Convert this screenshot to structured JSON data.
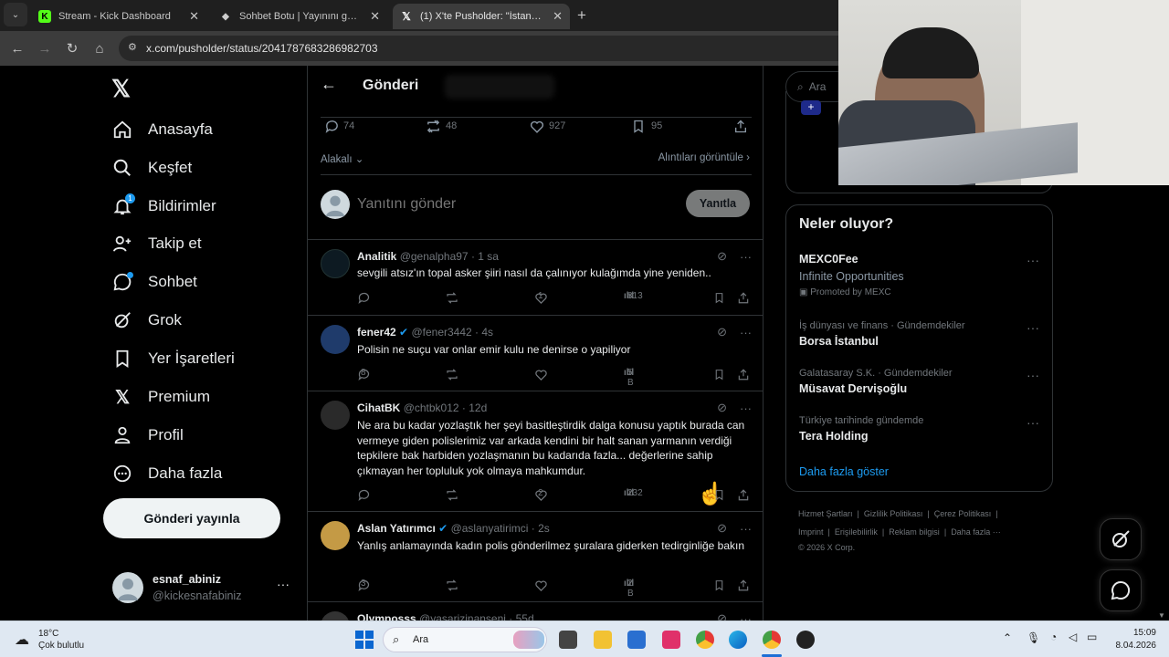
{
  "browser": {
    "tabs": [
      {
        "title": "Stream - Kick Dashboard",
        "icon": "kick-icon"
      },
      {
        "title": "Sohbet Botu | Yayınını güçlendir",
        "icon": "bot-icon"
      },
      {
        "title": "(1) X'te Pusholder: \"İstanbul Cu",
        "icon": "x-icon"
      }
    ],
    "url": "x.com/pusholder/status/2041787683286982703"
  },
  "nav": {
    "items": [
      {
        "label": "Anasayfa"
      },
      {
        "label": "Keşfet"
      },
      {
        "label": "Bildirimler",
        "badge": "1"
      },
      {
        "label": "Takip et"
      },
      {
        "label": "Sohbet"
      },
      {
        "label": "Grok"
      },
      {
        "label": "Yer İşaretleri"
      },
      {
        "label": "Premium"
      },
      {
        "label": "Profil"
      },
      {
        "label": "Daha fazla"
      }
    ],
    "post_button": "Gönderi yayınla",
    "account": {
      "name": "esnaf_abiniz",
      "handle": "@kickesnafabiniz"
    }
  },
  "post": {
    "header_title": "Gönderi",
    "stats": {
      "replies": "74",
      "reposts": "48",
      "likes": "927",
      "bookmarks": "95"
    },
    "sort_label": "Alakalı",
    "quotes_label": "Alıntıları görüntüle",
    "reply_placeholder": "Yanıtını gönder",
    "reply_button": "Yanıtla"
  },
  "replies": [
    {
      "name": "Analitik",
      "handle": "@genalpha97",
      "time": "· 1 sa",
      "verified": false,
      "text": "sevgili atsız'ın topal asker şiiri nasıl da çalınıyor kulağımda yine yeniden..",
      "likes": "1",
      "views": "813"
    },
    {
      "name": "fener42",
      "handle": "@fener3442",
      "time": "· 4s",
      "verified": true,
      "text": "Polisin ne suçu var onlar emir kulu ne denirse o yapiliyor",
      "likes": "",
      "views": "5 B",
      "replies": "8"
    },
    {
      "name": "CihatBK",
      "handle": "@chtbk012",
      "time": "· 12d",
      "verified": false,
      "text": "Ne ara bu kadar yozlaştık her şeyi basitleştirdik dalga konusu yaptık burada can vermeye giden polislerimiz var arkada kendini bir halt sanan yarmanın verdiği tepkilere bak harbiden yozlaşmanın bu kadarıda fazla... değerlerine sahip çıkmayan her topluluk yok olmaya mahkumdur.",
      "likes": "2",
      "views": "232"
    },
    {
      "name": "Aslan Yatırımcı",
      "handle": "@aslanyatirimci",
      "time": "· 2s",
      "verified": true,
      "text": "Yanlış anlamayında kadın polis gönderilmez şuralara giderken tedirginliğe bakın",
      "likes": "",
      "views": "2 B",
      "replies": "3"
    },
    {
      "name": "Olymposss",
      "handle": "@yasarizinanseni",
      "time": "· 55d",
      "verified": false,
      "text": ""
    }
  ],
  "right": {
    "search_placeholder": "Ara",
    "trends_title": "Neler oluyor?",
    "promo": {
      "name": "MEXC0Fee",
      "sub": "Infinite Opportunities",
      "promoted": "Promoted by MEXC"
    },
    "trends": [
      {
        "context": "İş dünyası ve finans · Gündemdekiler",
        "title": "Borsa İstanbul"
      },
      {
        "context": "Galatasaray S.K. · Gündemdekiler",
        "title": "Müsavat Dervişoğlu"
      },
      {
        "context": "Türkiye tarihinde gündemde",
        "title": "Tera Holding"
      }
    ],
    "show_more": "Daha fazla göster",
    "footer": [
      "Hizmet Şartları",
      "|",
      "Gizlilik Politikası",
      "|",
      "Çerez Politikası",
      "|",
      "Imprint",
      "|",
      "Erişilebilirlik",
      "|",
      "Reklam bilgisi",
      "|",
      "Daha fazla ···",
      "© 2026 X Corp."
    ]
  },
  "taskbar": {
    "weather_temp": "18°C",
    "weather_desc": "Çok bulutlu",
    "search": "Ara",
    "time": "15:09",
    "date": "8.04.2026"
  }
}
